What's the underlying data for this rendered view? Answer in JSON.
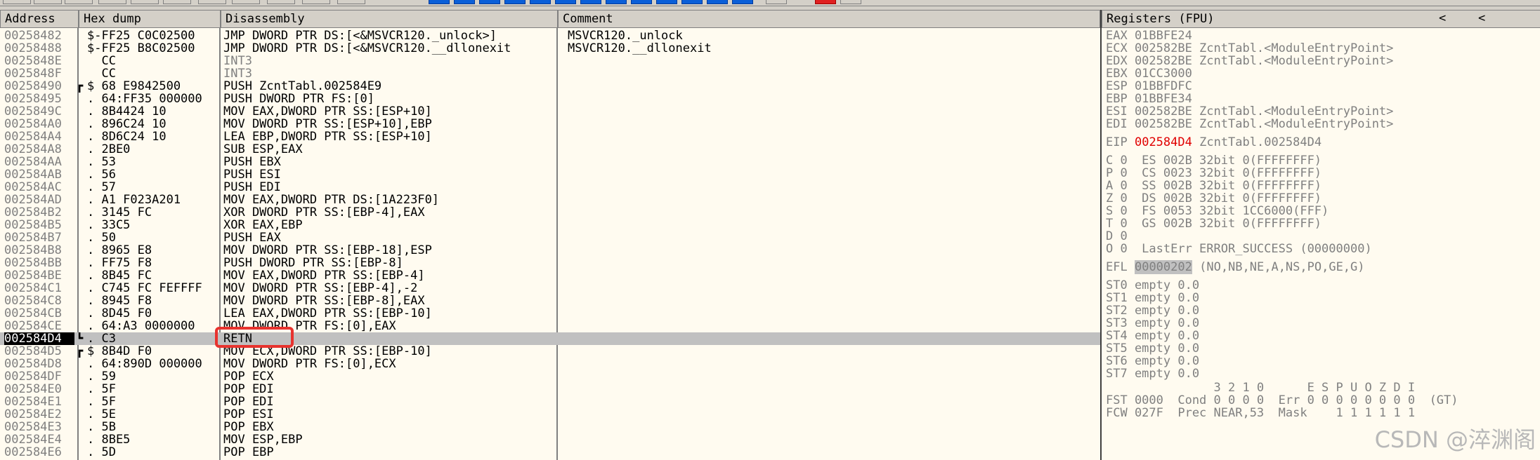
{
  "columns": {
    "address": "Address",
    "hexdump": "Hex dump",
    "disassembly": "Disassembly",
    "comment": "Comment"
  },
  "rows": [
    {
      "addr": "00258482",
      "br": "",
      "hex": "$-FF25 C0C02500",
      "dis": "JMP DWORD PTR DS:[<&MSVCR120._unlock>]",
      "cmt": "MSVCR120._unlock"
    },
    {
      "addr": "00258488",
      "br": "",
      "hex": "$-FF25 B8C02500",
      "dis": "JMP DWORD PTR DS:[<&MSVCR120.__dllonexit",
      "cmt": "MSVCR120.__dllonexit"
    },
    {
      "addr": "0025848E",
      "br": "",
      "hex": "  CC",
      "dis": "INT3",
      "cmt": "",
      "dimdis": true
    },
    {
      "addr": "0025848F",
      "br": "",
      "hex": "  CC",
      "dis": "INT3",
      "cmt": "",
      "dimdis": true
    },
    {
      "addr": "00258490",
      "br": "┏",
      "hex": "$ 68 E9842500",
      "dis": "PUSH ZcntTabl.002584E9",
      "cmt": ""
    },
    {
      "addr": "00258495",
      "br": "",
      "hex": ". 64:FF35 000000",
      "dis": "PUSH DWORD PTR FS:[0]",
      "cmt": ""
    },
    {
      "addr": "0025849C",
      "br": "",
      "hex": ". 8B4424 10",
      "dis": "MOV EAX,DWORD PTR SS:[ESP+10]",
      "cmt": ""
    },
    {
      "addr": "002584A0",
      "br": "",
      "hex": ". 896C24 10",
      "dis": "MOV DWORD PTR SS:[ESP+10],EBP",
      "cmt": ""
    },
    {
      "addr": "002584A4",
      "br": "",
      "hex": ". 8D6C24 10",
      "dis": "LEA EBP,DWORD PTR SS:[ESP+10]",
      "cmt": ""
    },
    {
      "addr": "002584A8",
      "br": "",
      "hex": ". 2BE0",
      "dis": "SUB ESP,EAX",
      "cmt": ""
    },
    {
      "addr": "002584AA",
      "br": "",
      "hex": ". 53",
      "dis": "PUSH EBX",
      "cmt": ""
    },
    {
      "addr": "002584AB",
      "br": "",
      "hex": ". 56",
      "dis": "PUSH ESI",
      "cmt": ""
    },
    {
      "addr": "002584AC",
      "br": "",
      "hex": ". 57",
      "dis": "PUSH EDI",
      "cmt": ""
    },
    {
      "addr": "002584AD",
      "br": "",
      "hex": ". A1 F023A201",
      "dis": "MOV EAX,DWORD PTR DS:[1A223F0]",
      "cmt": ""
    },
    {
      "addr": "002584B2",
      "br": "",
      "hex": ". 3145 FC",
      "dis": "XOR DWORD PTR SS:[EBP-4],EAX",
      "cmt": ""
    },
    {
      "addr": "002584B5",
      "br": "",
      "hex": ". 33C5",
      "dis": "XOR EAX,EBP",
      "cmt": ""
    },
    {
      "addr": "002584B7",
      "br": "",
      "hex": ". 50",
      "dis": "PUSH EAX",
      "cmt": ""
    },
    {
      "addr": "002584B8",
      "br": "",
      "hex": ". 8965 E8",
      "dis": "MOV DWORD PTR SS:[EBP-18],ESP",
      "cmt": ""
    },
    {
      "addr": "002584BB",
      "br": "",
      "hex": ". FF75 F8",
      "dis": "PUSH DWORD PTR SS:[EBP-8]",
      "cmt": ""
    },
    {
      "addr": "002584BE",
      "br": "",
      "hex": ". 8B45 FC",
      "dis": "MOV EAX,DWORD PTR SS:[EBP-4]",
      "cmt": ""
    },
    {
      "addr": "002584C1",
      "br": "",
      "hex": ". C745 FC FEFFFF",
      "dis": "MOV DWORD PTR SS:[EBP-4],-2",
      "cmt": ""
    },
    {
      "addr": "002584C8",
      "br": "",
      "hex": ". 8945 F8",
      "dis": "MOV DWORD PTR SS:[EBP-8],EAX",
      "cmt": ""
    },
    {
      "addr": "002584CB",
      "br": "",
      "hex": ". 8D45 F0",
      "dis": "LEA EAX,DWORD PTR SS:[EBP-10]",
      "cmt": ""
    },
    {
      "addr": "002584CE",
      "br": "",
      "hex": ". 64:A3 0000000",
      "dis": "MOV DWORD PTR FS:[0],EAX",
      "cmt": ""
    },
    {
      "addr": "002584D4",
      "br": "┗",
      "hex": ". C3",
      "dis": "RETN",
      "cmt": "",
      "selected": true
    },
    {
      "addr": "002584D5",
      "br": "┏",
      "hex": "$ 8B4D F0",
      "dis": "MOV ECX,DWORD PTR SS:[EBP-10]",
      "cmt": ""
    },
    {
      "addr": "002584D8",
      "br": "",
      "hex": ". 64:890D 000000",
      "dis": "MOV DWORD PTR FS:[0],ECX",
      "cmt": ""
    },
    {
      "addr": "002584DF",
      "br": "",
      "hex": ". 59",
      "dis": "POP ECX",
      "cmt": ""
    },
    {
      "addr": "002584E0",
      "br": "",
      "hex": ". 5F",
      "dis": "POP EDI",
      "cmt": ""
    },
    {
      "addr": "002584E1",
      "br": "",
      "hex": ". 5F",
      "dis": "POP EDI",
      "cmt": ""
    },
    {
      "addr": "002584E2",
      "br": "",
      "hex": ". 5E",
      "dis": "POP ESI",
      "cmt": ""
    },
    {
      "addr": "002584E3",
      "br": "",
      "hex": ". 5B",
      "dis": "POP EBX",
      "cmt": ""
    },
    {
      "addr": "002584E4",
      "br": "",
      "hex": ". 8BE5",
      "dis": "MOV ESP,EBP",
      "cmt": ""
    },
    {
      "addr": "002584E6",
      "br": "",
      "hex": ". 5D",
      "dis": "POP EBP",
      "cmt": ""
    }
  ],
  "registers": {
    "title": "Registers (FPU)",
    "arrows": [
      "<",
      "<"
    ],
    "gpr": [
      "EAX 01BBFE24",
      "ECX 002582BE ZcntTabl.<ModuleEntryPoint>",
      "EDX 002582BE ZcntTabl.<ModuleEntryPoint>",
      "EBX 01CC3000",
      "ESP 01BBFDFC",
      "EBP 01BBFE34",
      "ESI 002582BE ZcntTabl.<ModuleEntryPoint>",
      "EDI 002582BE ZcntTabl.<ModuleEntryPoint>"
    ],
    "eip_label": "EIP",
    "eip_value": "002584D4",
    "eip_comment": "ZcntTabl.002584D4",
    "flags": [
      "C 0  ES 002B 32bit 0(FFFFFFFF)",
      "P 0  CS 0023 32bit 0(FFFFFFFF)",
      "A 0  SS 002B 32bit 0(FFFFFFFF)",
      "Z 0  DS 002B 32bit 0(FFFFFFFF)",
      "S 0  FS 0053 32bit 1CC6000(FFF)",
      "T 0  GS 002B 32bit 0(FFFFFFFF)",
      "D 0",
      "O 0  LastErr ERROR_SUCCESS (00000000)"
    ],
    "efl_label": "EFL",
    "efl_value": "00000202",
    "efl_flags": "(NO,NB,NE,A,NS,PO,GE,G)",
    "st": [
      "ST0 empty 0.0",
      "ST1 empty 0.0",
      "ST2 empty 0.0",
      "ST3 empty 0.0",
      "ST4 empty 0.0",
      "ST5 empty 0.0",
      "ST6 empty 0.0",
      "ST7 empty 0.0"
    ],
    "fpu_header": "               3 2 1 0      E S P U O Z D I",
    "fst": "FST 0000  Cond 0 0 0 0  Err 0 0 0 0 0 0 0 0  (GT)",
    "fcw": "FCW 027F  Prec NEAR,53  Mask    1 1 1 1 1 1"
  },
  "watermark": "CSDN @淬渊阁",
  "colors": {
    "highlight_box": "#e8332e",
    "eip": "#e00000",
    "pane_bg": "#fffbf0"
  }
}
